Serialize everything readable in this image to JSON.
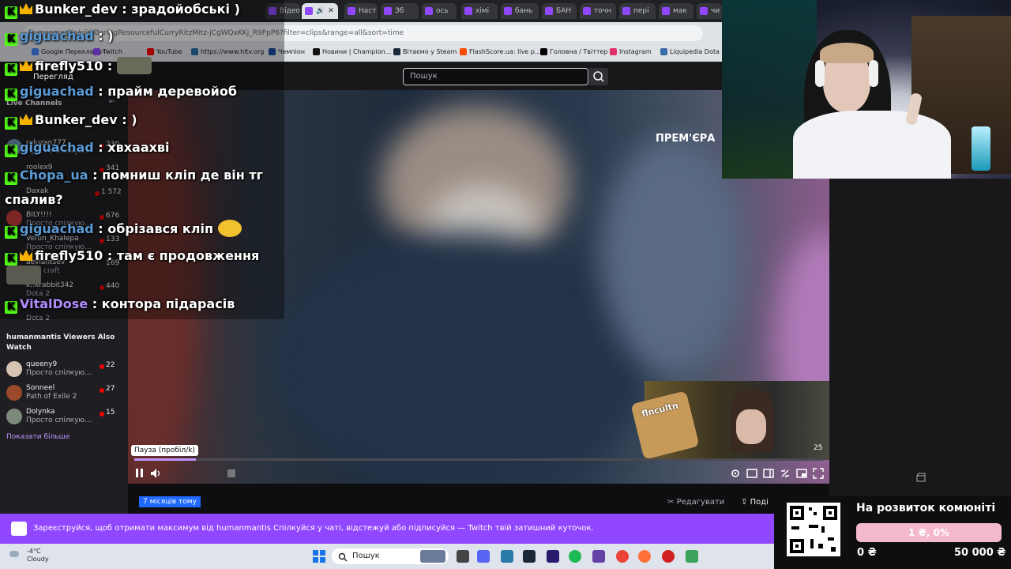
{
  "browser": {
    "tabs": [
      {
        "label": "Відео"
      },
      {
        "label": "",
        "active": true
      },
      {
        "label": "Наст"
      },
      {
        "label": "Зб"
      },
      {
        "label": "ось"
      },
      {
        "label": "хімі"
      },
      {
        "label": "бань"
      },
      {
        "label": "БАН"
      },
      {
        "label": "точн"
      },
      {
        "label": "пері"
      },
      {
        "label": "мак"
      },
      {
        "label": "чи"
      }
    ],
    "url": "humanmantis/clip/BoringResourcefulCurryRitzMitz-jCgWQxKKj_R9PpP6?filter=clips&range=all&sort=time",
    "bookmarks": [
      "Google Перекладач",
      "Twitch",
      "YouTube",
      "https://www.hltv.org",
      "Чемпіон",
      "Новини | Champion...",
      "Вітаємо у Steam",
      "FlashScore.ua: live p...",
      "Головна / Твіттер",
      "Instagram",
      "Liquipedia Dota 2..."
    ]
  },
  "twitch": {
    "search_placeholder": "Пошук",
    "sidebar": {
      "header": "Перегляд",
      "live_title": "Live Channels",
      "channels": [
        {
          "name": "raluzan777",
          "sub": "Просто спілкую...",
          "count": "230"
        },
        {
          "name": "roolex9",
          "sub": "",
          "count": "341"
        },
        {
          "name": "Daxak",
          "sub": "",
          "count": "1 572"
        },
        {
          "name": "BILY!!!!",
          "sub": "Просто спілкую...",
          "count": "676"
        },
        {
          "name": "Veron_Khalepa",
          "sub": "Просто спілкую...",
          "count": "133"
        },
        {
          "name": "aevlantsev",
          "sub": "craft",
          "count": "169"
        },
        {
          "name": "k..xrabbit342",
          "sub": "Dota 2",
          "count": "440"
        },
        {
          "name": "",
          "sub": "Dota 2",
          "count": ""
        }
      ],
      "also_watch_title": "humanmantis Viewers Also Watch",
      "also_watch": [
        {
          "name": "queeny9",
          "sub": "Просто спілкую...",
          "count": "22"
        },
        {
          "name": "Sonneel",
          "sub": "Path of Exile 2",
          "count": "27"
        },
        {
          "name": "Dolynka",
          "sub": "Просто спілкую...",
          "count": "15"
        }
      ],
      "show_more": "Показати більше"
    },
    "video": {
      "premiere_label": "ПРЕМ'ЄРА",
      "tooltip": "Пауза (пробіл/k)",
      "cam_label": "flncultn",
      "cam_count": "25",
      "progress": 0.09,
      "age_badge": "7 місяців тому",
      "edit_label": "Редагувати",
      "share_label": "Поді"
    },
    "banner": "Зареєструйся, щоб отримати максимум від humanmantis  Спілкуйся у чаті, відстежуй або підписуйся — Twitch твій затишний куточок."
  },
  "chat": {
    "messages": [
      {
        "user": "Bunker_dev",
        "color": "#ffffff",
        "text": ": зрадойобські )",
        "badges": [
          "k",
          "crown"
        ]
      },
      {
        "user": "giguachad",
        "color": "#5b9bd5",
        "text": ": )",
        "badges": [
          "k"
        ]
      },
      {
        "user": "firefly510",
        "color": "#ffffff",
        "text": ":",
        "badges": [
          "k",
          "crown"
        ]
      },
      {
        "user": "giguachad",
        "color": "#5b9bd5",
        "text": ": прайм деревойоб",
        "badges": [
          "k"
        ]
      },
      {
        "user": "Bunker_dev",
        "color": "#ffffff",
        "text": ": )",
        "badges": [
          "k",
          "crown"
        ]
      },
      {
        "user": "giguachad",
        "color": "#5b9bd5",
        "text": ": хвхаахві",
        "badges": [
          "k"
        ]
      },
      {
        "user": "Chopa_ua",
        "color": "#5b9bd5",
        "text": ": помниш кліп де він тг",
        "badges": [
          "k"
        ]
      },
      {
        "user": "",
        "color": "#ffffff",
        "text": "спалив?",
        "badges": []
      },
      {
        "user": "giguachad",
        "color": "#5b9bd5",
        "text": ": обрізався кліп",
        "badges": [
          "k"
        ]
      },
      {
        "user": "firefly510",
        "color": "#ffffff",
        "text": ": там є продовження",
        "badges": [
          "k",
          "crown"
        ]
      },
      {
        "user": "VitalDose",
        "color": "#b08cff",
        "text": ": контора підарасів",
        "badges": [
          "k"
        ]
      }
    ]
  },
  "donation": {
    "title": "На розвиток комюніті",
    "progress_text": "1 ₴, 0%",
    "min": "0 ₴",
    "max": "50 000 ₴"
  },
  "taskbar": {
    "weather_temp": "-4°C",
    "weather_desc": "Cloudy",
    "search": "Пошук"
  }
}
